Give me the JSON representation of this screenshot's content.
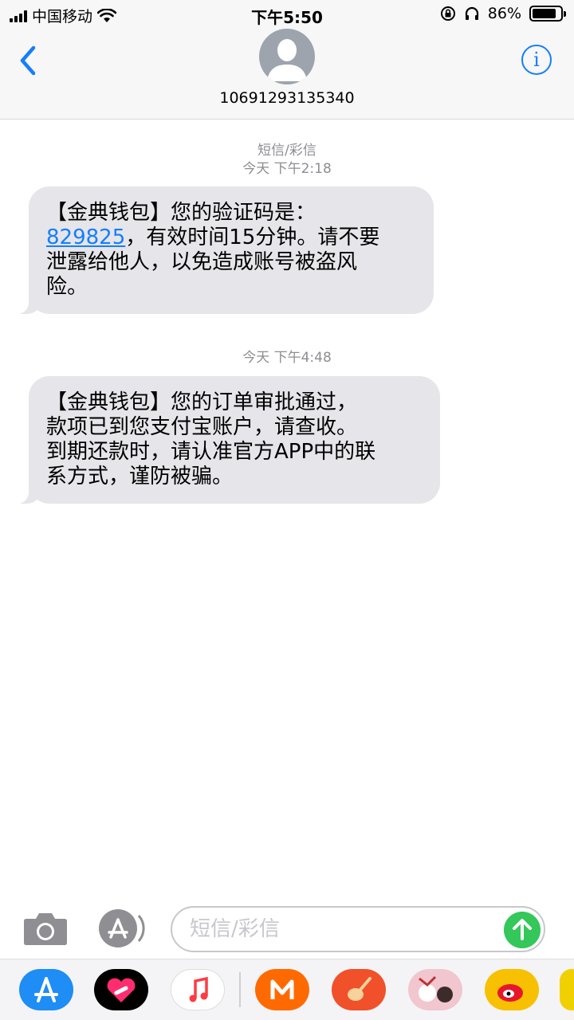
{
  "status_bar": {
    "carrier": "中国移动",
    "time": "下午5:50",
    "battery": "86%",
    "battery_level": 0.86
  },
  "header": {
    "contact": "10691293135340"
  },
  "thread": {
    "type_label": "短信/彩信",
    "messages": [
      {
        "timestamp": "今天 下午2:18",
        "code": "829825",
        "line1": "【金典钱包】您的验证码是：",
        "rest": "，有效时间15分钟。请不要",
        "line3": "泄露给他人，以免造成账号被盗风",
        "line4": "险。"
      },
      {
        "timestamp": "今天 下午4:48",
        "line1": "【金典钱包】您的订单审批通过，",
        "line2": "款项已到您支付宝账户，请查收。",
        "line3": "到期还款时，请认准官方APP中的联",
        "line4": "系方式，谨防被骗。"
      }
    ]
  },
  "composer": {
    "placeholder": "短信/彩信"
  },
  "colors": {
    "accent": "#157efb",
    "bubble": "#e5e5ea",
    "send": "#34c759"
  },
  "app_drawer": [
    "app-store-icon",
    "heart-digital-touch-icon",
    "music-icon",
    "mango-tv-icon",
    "garageband-icon",
    "cartoon-sticker-icon",
    "weibo-icon"
  ]
}
